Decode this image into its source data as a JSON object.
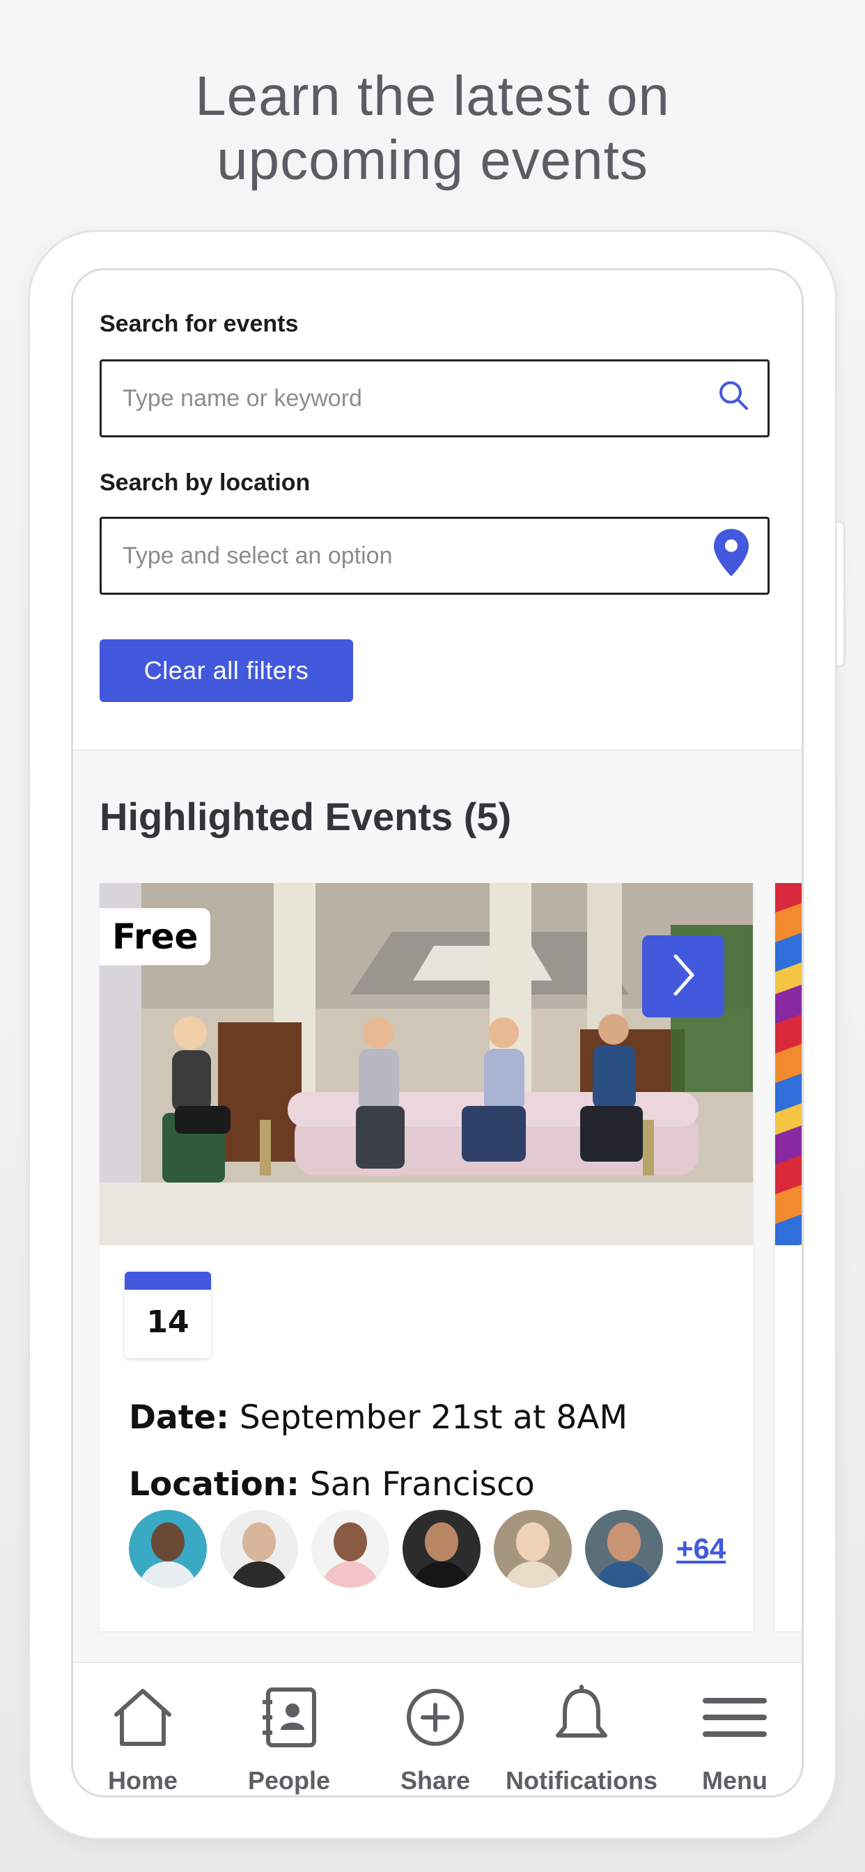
{
  "headline": {
    "line1": "Learn the latest on",
    "line2": "upcoming events"
  },
  "search": {
    "events_label": "Search for events",
    "events_placeholder": "Type name or keyword",
    "location_label": "Search by location",
    "location_placeholder": "Type and select an option",
    "clear_button": "Clear all filters"
  },
  "highlighted": {
    "title": "Highlighted Events (5)",
    "card": {
      "badge": "Free",
      "calendar_day": "14",
      "date_label": "Date:",
      "date_value": "September 21st at 8AM",
      "location_label": "Location:",
      "location_value": "San Francisco",
      "attendees_more": "+64"
    }
  },
  "tabs": [
    {
      "label": "Home",
      "icon": "home-icon"
    },
    {
      "label": "People",
      "icon": "contacts-icon"
    },
    {
      "label": "Share",
      "icon": "plus-circle-icon"
    },
    {
      "label": "Notifications",
      "icon": "bell-icon"
    },
    {
      "label": "Menu",
      "icon": "menu-icon"
    }
  ],
  "colors": {
    "accent": "#4259de",
    "headline": "#5c5d63",
    "tab_text": "#5f5f63"
  }
}
